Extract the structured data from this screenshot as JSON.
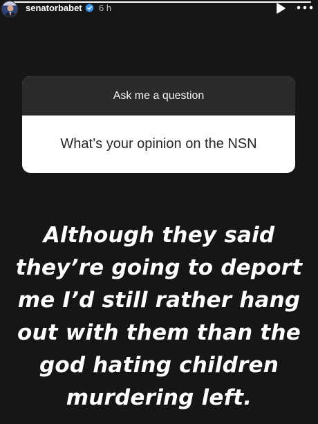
{
  "header": {
    "username": "senatorbabet",
    "timestamp": "6 h",
    "avatar_icon": "profile-avatar",
    "verified_icon": "verified-badge-icon",
    "play_icon": "play-icon",
    "more_icon": "more-options-icon"
  },
  "progress": {
    "fraction": 1.0
  },
  "question_sticker": {
    "prompt": "Ask me a question",
    "question": "What’s your opinion on the NSN"
  },
  "caption": {
    "lines": [
      "Although they said",
      "they’re going to deport",
      "me I’d still rather hang",
      "out with them than the",
      "god hating children",
      "murdering left."
    ]
  },
  "colors": {
    "background": "#161616",
    "card_header": "#2b2b2b",
    "card_body": "#ffffff",
    "verified_blue": "#3897f0",
    "text_white": "#ffffff"
  }
}
